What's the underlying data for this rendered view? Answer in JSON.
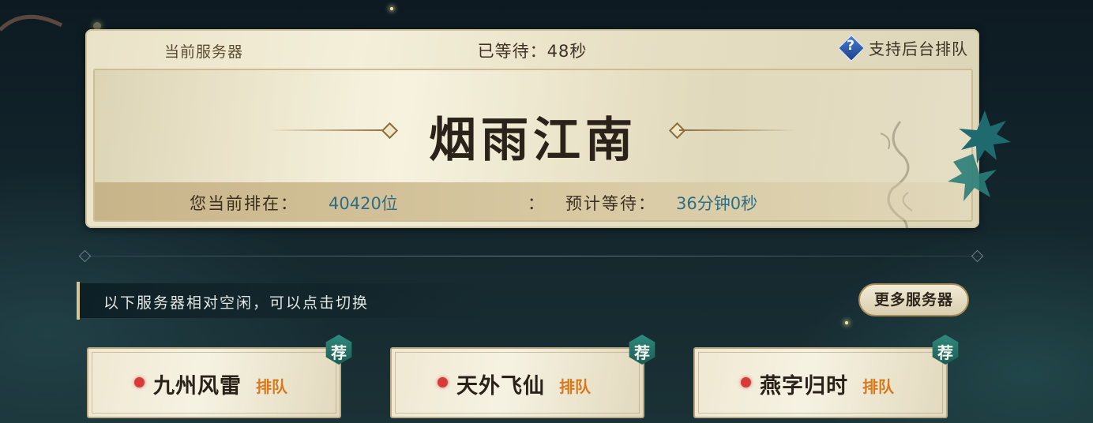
{
  "queue": {
    "current_server_label": "当前服务器",
    "waited_text": "已等待：48秒",
    "background_queue_label": "支持后台排队",
    "server_name": "烟雨江南",
    "rank_label": "您当前排在：",
    "rank_value": "40420位",
    "separator": "：",
    "eta_label": "预计等待：",
    "eta_value": "36分钟0秒"
  },
  "idle_section": {
    "hint_text": "以下服务器相对空闲，可以点击切换",
    "more_button_label": "更多服务器"
  },
  "servers": [
    {
      "name": "九州风雷",
      "status": "排队",
      "badge": "荐"
    },
    {
      "name": "天外飞仙",
      "status": "排队",
      "badge": "荐"
    },
    {
      "name": "燕字归时",
      "status": "排队",
      "badge": "荐"
    }
  ],
  "colors": {
    "accent_blue": "#2e6e84",
    "queue_status": "#d77a1f",
    "status_dot": "#d63a3a",
    "badge_green": "#2f8a7c"
  },
  "icons": {
    "help": "question-diamond-icon",
    "status": "red-dot-icon"
  }
}
